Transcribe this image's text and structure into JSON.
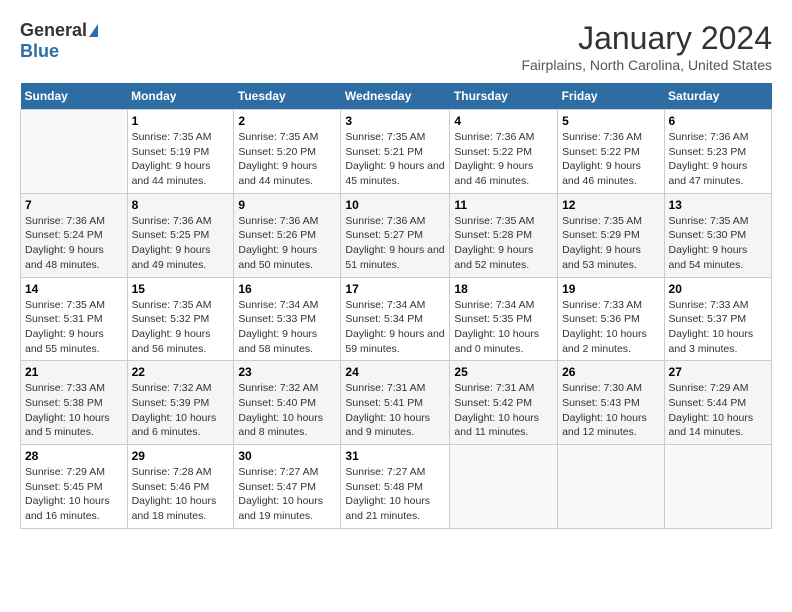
{
  "logo": {
    "general": "General",
    "blue": "Blue"
  },
  "title": "January 2024",
  "location": "Fairplains, North Carolina, United States",
  "days_header": [
    "Sunday",
    "Monday",
    "Tuesday",
    "Wednesday",
    "Thursday",
    "Friday",
    "Saturday"
  ],
  "weeks": [
    [
      {
        "day": "",
        "sunrise": "",
        "sunset": "",
        "daylight": ""
      },
      {
        "day": "1",
        "sunrise": "Sunrise: 7:35 AM",
        "sunset": "Sunset: 5:19 PM",
        "daylight": "Daylight: 9 hours and 44 minutes."
      },
      {
        "day": "2",
        "sunrise": "Sunrise: 7:35 AM",
        "sunset": "Sunset: 5:20 PM",
        "daylight": "Daylight: 9 hours and 44 minutes."
      },
      {
        "day": "3",
        "sunrise": "Sunrise: 7:35 AM",
        "sunset": "Sunset: 5:21 PM",
        "daylight": "Daylight: 9 hours and 45 minutes."
      },
      {
        "day": "4",
        "sunrise": "Sunrise: 7:36 AM",
        "sunset": "Sunset: 5:22 PM",
        "daylight": "Daylight: 9 hours and 46 minutes."
      },
      {
        "day": "5",
        "sunrise": "Sunrise: 7:36 AM",
        "sunset": "Sunset: 5:22 PM",
        "daylight": "Daylight: 9 hours and 46 minutes."
      },
      {
        "day": "6",
        "sunrise": "Sunrise: 7:36 AM",
        "sunset": "Sunset: 5:23 PM",
        "daylight": "Daylight: 9 hours and 47 minutes."
      }
    ],
    [
      {
        "day": "7",
        "sunrise": "Sunrise: 7:36 AM",
        "sunset": "Sunset: 5:24 PM",
        "daylight": "Daylight: 9 hours and 48 minutes."
      },
      {
        "day": "8",
        "sunrise": "Sunrise: 7:36 AM",
        "sunset": "Sunset: 5:25 PM",
        "daylight": "Daylight: 9 hours and 49 minutes."
      },
      {
        "day": "9",
        "sunrise": "Sunrise: 7:36 AM",
        "sunset": "Sunset: 5:26 PM",
        "daylight": "Daylight: 9 hours and 50 minutes."
      },
      {
        "day": "10",
        "sunrise": "Sunrise: 7:36 AM",
        "sunset": "Sunset: 5:27 PM",
        "daylight": "Daylight: 9 hours and 51 minutes."
      },
      {
        "day": "11",
        "sunrise": "Sunrise: 7:35 AM",
        "sunset": "Sunset: 5:28 PM",
        "daylight": "Daylight: 9 hours and 52 minutes."
      },
      {
        "day": "12",
        "sunrise": "Sunrise: 7:35 AM",
        "sunset": "Sunset: 5:29 PM",
        "daylight": "Daylight: 9 hours and 53 minutes."
      },
      {
        "day": "13",
        "sunrise": "Sunrise: 7:35 AM",
        "sunset": "Sunset: 5:30 PM",
        "daylight": "Daylight: 9 hours and 54 minutes."
      }
    ],
    [
      {
        "day": "14",
        "sunrise": "Sunrise: 7:35 AM",
        "sunset": "Sunset: 5:31 PM",
        "daylight": "Daylight: 9 hours and 55 minutes."
      },
      {
        "day": "15",
        "sunrise": "Sunrise: 7:35 AM",
        "sunset": "Sunset: 5:32 PM",
        "daylight": "Daylight: 9 hours and 56 minutes."
      },
      {
        "day": "16",
        "sunrise": "Sunrise: 7:34 AM",
        "sunset": "Sunset: 5:33 PM",
        "daylight": "Daylight: 9 hours and 58 minutes."
      },
      {
        "day": "17",
        "sunrise": "Sunrise: 7:34 AM",
        "sunset": "Sunset: 5:34 PM",
        "daylight": "Daylight: 9 hours and 59 minutes."
      },
      {
        "day": "18",
        "sunrise": "Sunrise: 7:34 AM",
        "sunset": "Sunset: 5:35 PM",
        "daylight": "Daylight: 10 hours and 0 minutes."
      },
      {
        "day": "19",
        "sunrise": "Sunrise: 7:33 AM",
        "sunset": "Sunset: 5:36 PM",
        "daylight": "Daylight: 10 hours and 2 minutes."
      },
      {
        "day": "20",
        "sunrise": "Sunrise: 7:33 AM",
        "sunset": "Sunset: 5:37 PM",
        "daylight": "Daylight: 10 hours and 3 minutes."
      }
    ],
    [
      {
        "day": "21",
        "sunrise": "Sunrise: 7:33 AM",
        "sunset": "Sunset: 5:38 PM",
        "daylight": "Daylight: 10 hours and 5 minutes."
      },
      {
        "day": "22",
        "sunrise": "Sunrise: 7:32 AM",
        "sunset": "Sunset: 5:39 PM",
        "daylight": "Daylight: 10 hours and 6 minutes."
      },
      {
        "day": "23",
        "sunrise": "Sunrise: 7:32 AM",
        "sunset": "Sunset: 5:40 PM",
        "daylight": "Daylight: 10 hours and 8 minutes."
      },
      {
        "day": "24",
        "sunrise": "Sunrise: 7:31 AM",
        "sunset": "Sunset: 5:41 PM",
        "daylight": "Daylight: 10 hours and 9 minutes."
      },
      {
        "day": "25",
        "sunrise": "Sunrise: 7:31 AM",
        "sunset": "Sunset: 5:42 PM",
        "daylight": "Daylight: 10 hours and 11 minutes."
      },
      {
        "day": "26",
        "sunrise": "Sunrise: 7:30 AM",
        "sunset": "Sunset: 5:43 PM",
        "daylight": "Daylight: 10 hours and 12 minutes."
      },
      {
        "day": "27",
        "sunrise": "Sunrise: 7:29 AM",
        "sunset": "Sunset: 5:44 PM",
        "daylight": "Daylight: 10 hours and 14 minutes."
      }
    ],
    [
      {
        "day": "28",
        "sunrise": "Sunrise: 7:29 AM",
        "sunset": "Sunset: 5:45 PM",
        "daylight": "Daylight: 10 hours and 16 minutes."
      },
      {
        "day": "29",
        "sunrise": "Sunrise: 7:28 AM",
        "sunset": "Sunset: 5:46 PM",
        "daylight": "Daylight: 10 hours and 18 minutes."
      },
      {
        "day": "30",
        "sunrise": "Sunrise: 7:27 AM",
        "sunset": "Sunset: 5:47 PM",
        "daylight": "Daylight: 10 hours and 19 minutes."
      },
      {
        "day": "31",
        "sunrise": "Sunrise: 7:27 AM",
        "sunset": "Sunset: 5:48 PM",
        "daylight": "Daylight: 10 hours and 21 minutes."
      },
      {
        "day": "",
        "sunrise": "",
        "sunset": "",
        "daylight": ""
      },
      {
        "day": "",
        "sunrise": "",
        "sunset": "",
        "daylight": ""
      },
      {
        "day": "",
        "sunrise": "",
        "sunset": "",
        "daylight": ""
      }
    ]
  ]
}
